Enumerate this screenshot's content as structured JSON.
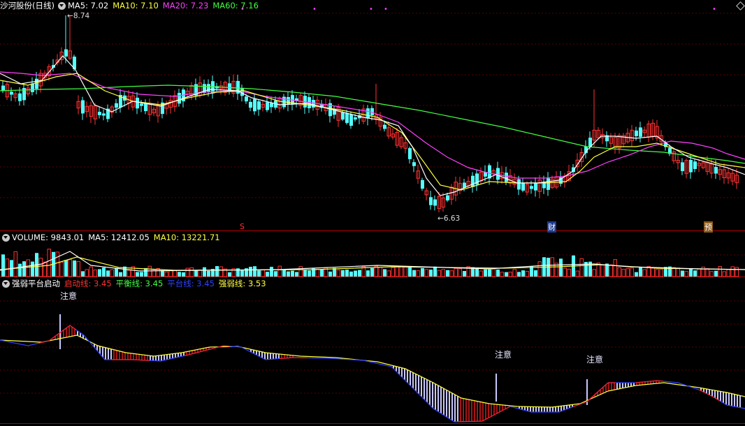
{
  "window": {
    "stock_title": "沙河股份(日线)"
  },
  "price_panel": {
    "ma_labels": [
      {
        "name": "MA5",
        "value": "7.02",
        "color": "#ffffff"
      },
      {
        "name": "MA10",
        "value": "7.10",
        "color": "#ffff40"
      },
      {
        "name": "MA20",
        "value": "7.23",
        "color": "#ff40ff"
      },
      {
        "name": "MA60",
        "value": "7.16",
        "color": "#40ff40"
      }
    ],
    "high_marker": "8.74",
    "low_marker": "6.63",
    "event_markers": [
      {
        "label": "S",
        "color": "#ff3030"
      },
      {
        "label": "财",
        "color": "#ffffff"
      },
      {
        "label": "预",
        "color": "#ffffff"
      }
    ],
    "colors": {
      "up": "#ff3232",
      "down": "#54ffff",
      "ma5": "#ffffff",
      "ma10": "#ffff40",
      "ma20": "#ff40ff",
      "ma60": "#40ff40"
    }
  },
  "volume_panel": {
    "title": "VOLUME: 9843.01",
    "ma_labels": [
      {
        "name": "MA5",
        "value": "12412.05",
        "color": "#ffffff"
      },
      {
        "name": "MA10",
        "value": "13221.71",
        "color": "#ffff40"
      }
    ]
  },
  "indicator_panel": {
    "title": "强弱平台启动",
    "lines": [
      {
        "name": "启动线",
        "value": "3.45",
        "color": "#ff3030"
      },
      {
        "name": "平衡线",
        "value": "3.45",
        "color": "#40ff40"
      },
      {
        "name": "平台线",
        "value": "3.45",
        "color": "#3040ff"
      },
      {
        "name": "强弱线",
        "value": "3.53",
        "color": "#ffff40"
      }
    ],
    "alert_label": "注意",
    "alerts": [
      "注意",
      "注意",
      "注意"
    ]
  },
  "chart_data": {
    "type": "candlestick",
    "last_values": {
      "MA5": 7.02,
      "MA10": 7.1,
      "MA20": 7.23,
      "MA60": 7.16
    },
    "visible_high": 8.74,
    "visible_low": 6.63,
    "volume": {
      "last": 9843.01,
      "MA5": 12412.05,
      "MA10": 13221.71
    },
    "indicator": {
      "启动线": 3.45,
      "平衡线": 3.45,
      "平台线": 3.45,
      "强弱线": 3.53
    }
  }
}
